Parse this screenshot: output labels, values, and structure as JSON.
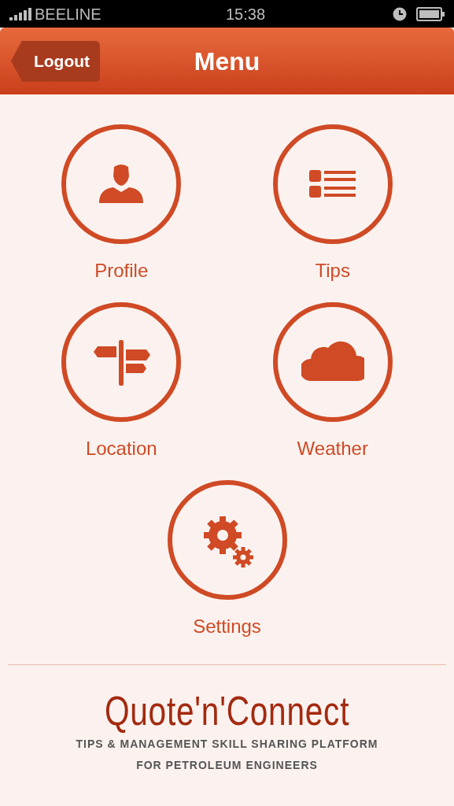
{
  "status_bar": {
    "carrier": "BEELINE",
    "time": "15:38"
  },
  "header": {
    "back_button": "Logout",
    "title": "Menu"
  },
  "menu_items": [
    {
      "label": "Profile",
      "kind": "person"
    },
    {
      "label": "Tips",
      "kind": "list"
    },
    {
      "label": "Location",
      "kind": "signpost"
    },
    {
      "label": "Weather",
      "kind": "cloud"
    },
    {
      "label": "Settings",
      "kind": "gears"
    }
  ],
  "footer": {
    "logo": "Quote'n'Connect",
    "tagline": [
      "TIPS & MANAGEMENT SKILL SHARING PLATFORM",
      "FOR PETROLEUM ENGINEERS"
    ]
  }
}
